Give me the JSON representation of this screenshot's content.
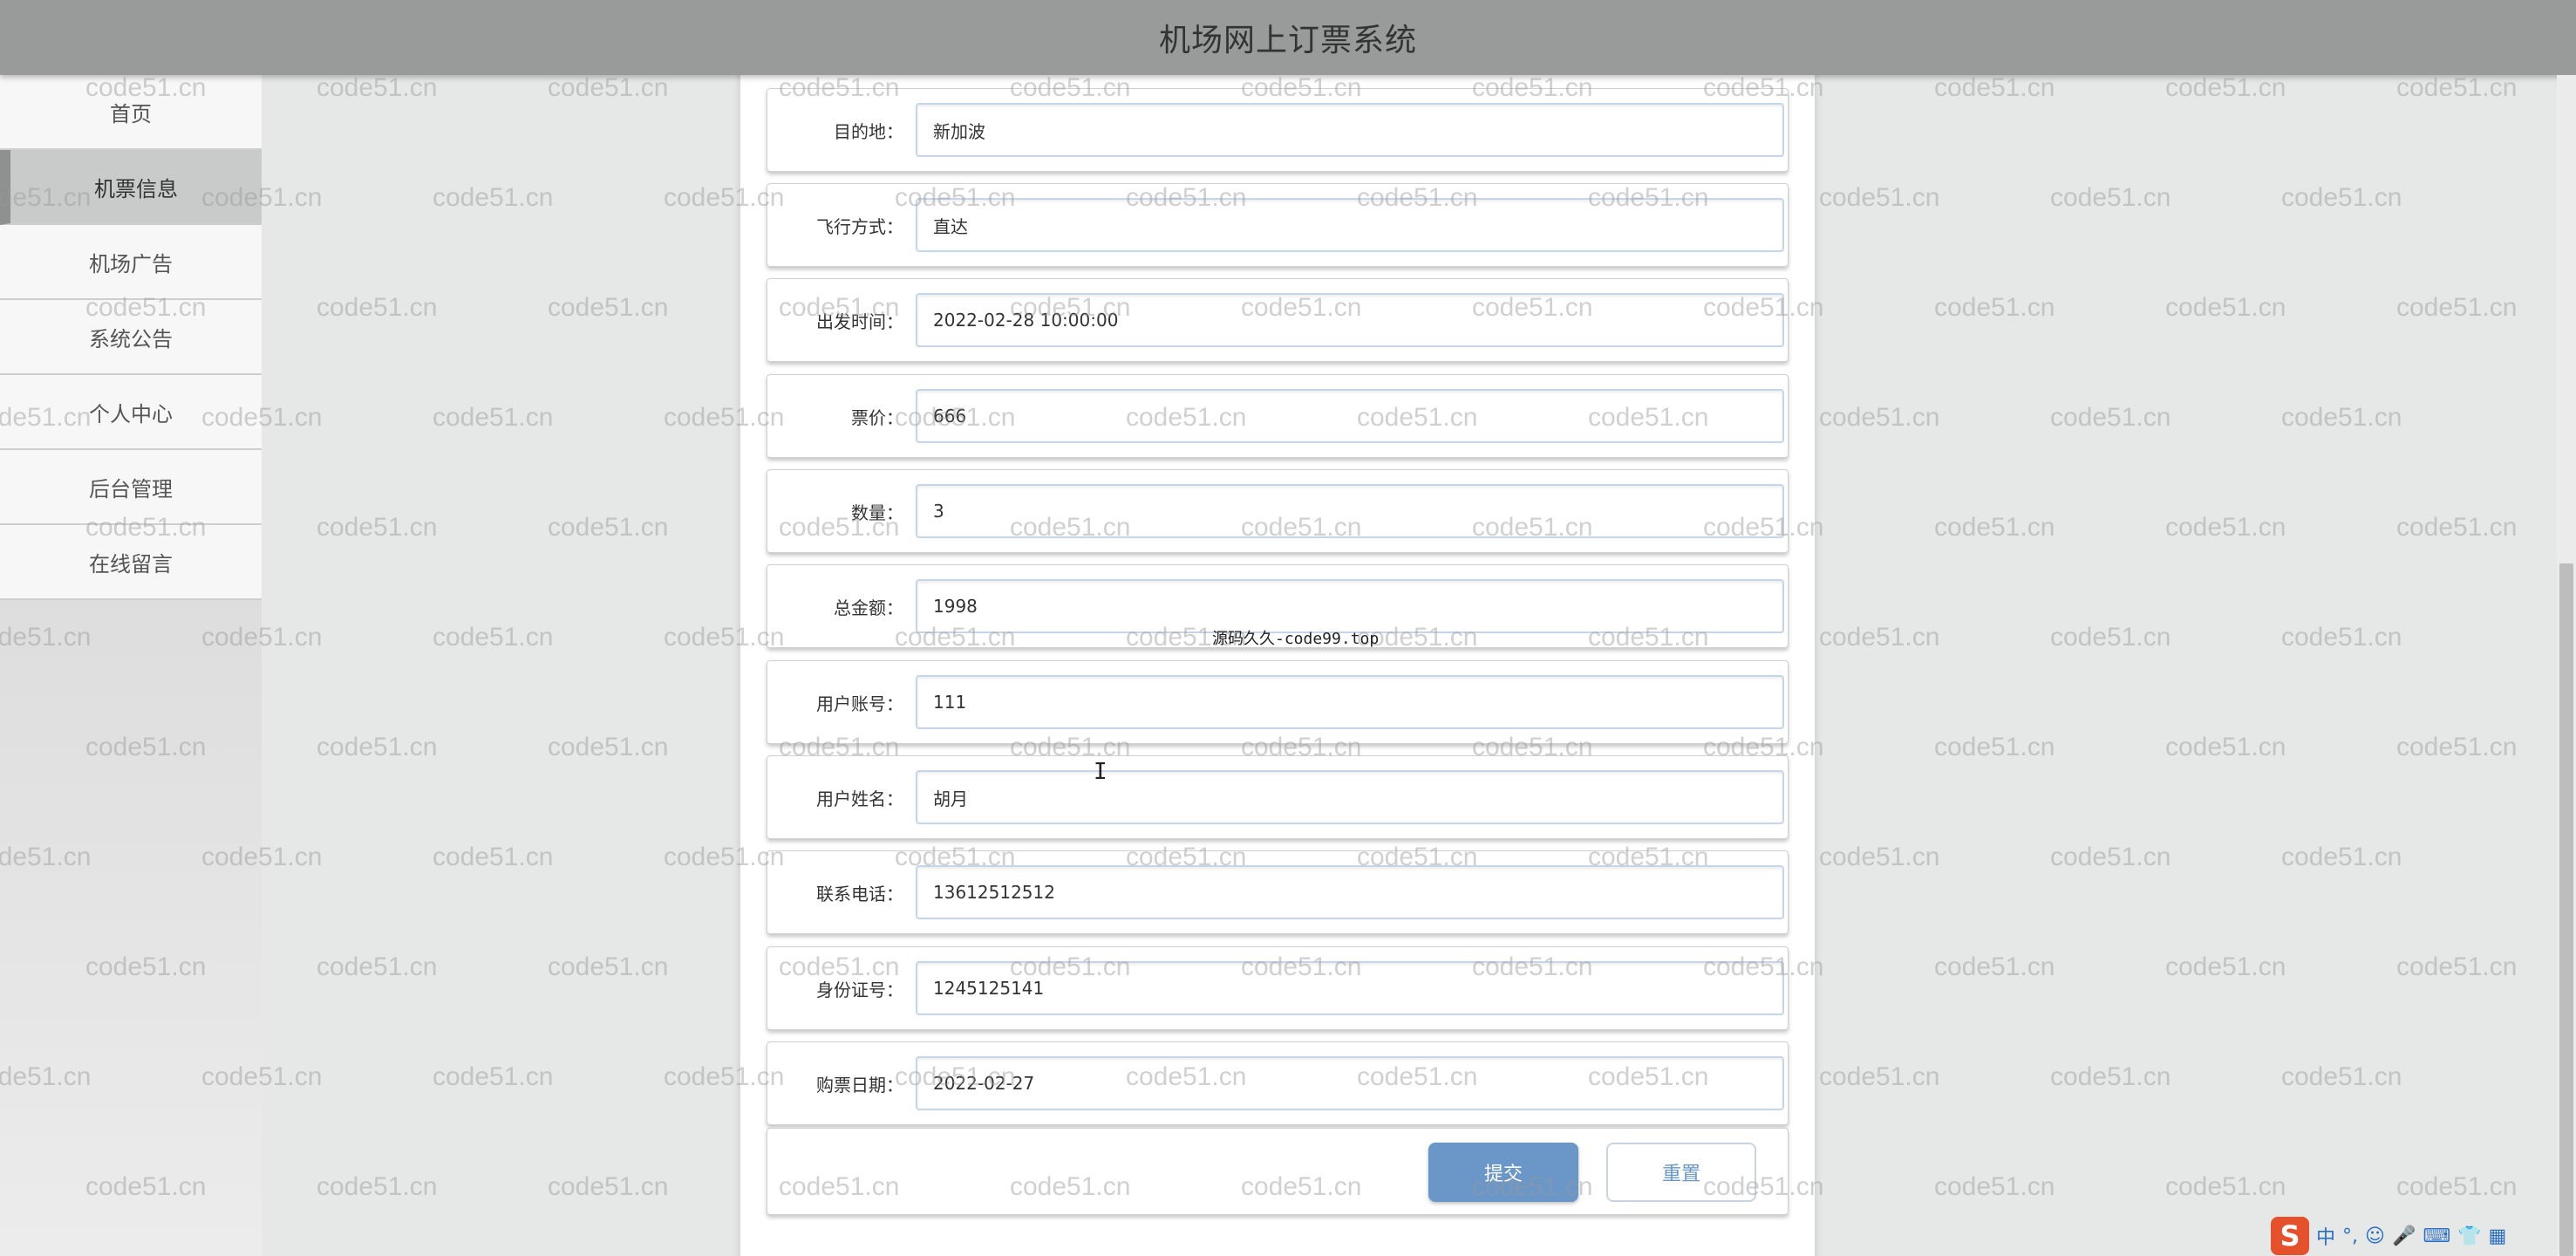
{
  "header": {
    "title": "机场网上订票系统"
  },
  "sidebar": {
    "items": [
      {
        "label": "首页",
        "active": false
      },
      {
        "label": "机票信息",
        "active": true
      },
      {
        "label": "机场广告",
        "active": false
      },
      {
        "label": "系统公告",
        "active": false
      },
      {
        "label": "个人中心",
        "active": false
      },
      {
        "label": "后台管理",
        "active": false
      },
      {
        "label": "在线留言",
        "active": false
      }
    ]
  },
  "form": {
    "fields": [
      {
        "label": "目的地：",
        "value": "新加波"
      },
      {
        "label": "飞行方式：",
        "value": "直达"
      },
      {
        "label": "出发时间：",
        "value": "2022-02-28 10:00:00"
      },
      {
        "label": "票价：",
        "value": "666"
      },
      {
        "label": "数量：",
        "value": "3"
      },
      {
        "label": "总金额：",
        "value": "1998"
      },
      {
        "label": "用户账号：",
        "value": "111"
      },
      {
        "label": "用户姓名：",
        "value": "胡月"
      },
      {
        "label": "联系电话：",
        "value": "13612512512"
      },
      {
        "label": "身份证号：",
        "value": "1245125141"
      },
      {
        "label": "购票日期：",
        "value": "2022-02-27"
      }
    ],
    "submit_label": "提交",
    "reset_label": "重置"
  },
  "overlay": {
    "watermark_text": "code51.cn",
    "source_mark": "源码久久-code99.top",
    "text_cursor": "I"
  },
  "ime_tray": {
    "logo": "S",
    "items": [
      "中",
      "°,",
      "☺",
      "🎤",
      "⌨",
      "👕",
      "▦"
    ]
  },
  "colors": {
    "header_bg": "#999b9b",
    "submit_bg": "#6b97c8",
    "sidebar_active": "#c9cbcb"
  }
}
